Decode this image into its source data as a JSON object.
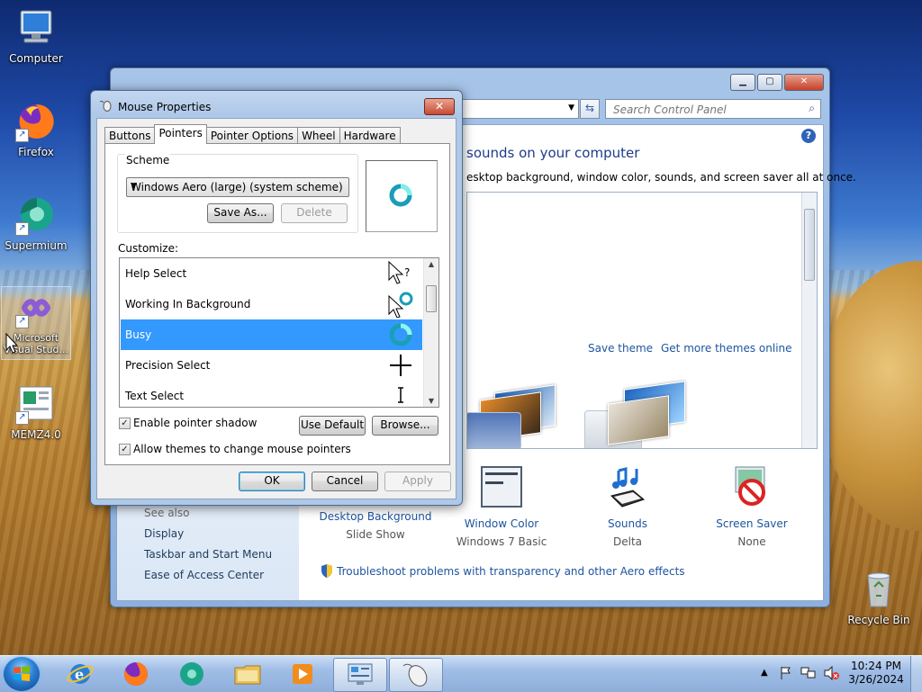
{
  "desktop": {
    "icons": [
      {
        "label": "Computer"
      },
      {
        "label": "Firefox"
      },
      {
        "label": "Supermium"
      },
      {
        "label": "Microsoft Visual Stud..."
      },
      {
        "label": "MEMZ4.0"
      },
      {
        "label": "Recycle Bin"
      }
    ]
  },
  "control_panel": {
    "search_placeholder": "Search Control Panel",
    "heading": "sounds on your computer",
    "subtext": "esktop background, window color, sounds, and screen saver all at once.",
    "save_theme": "Save theme",
    "more_themes": "Get more themes online",
    "tiles": [
      {
        "label": "Desktop Background",
        "sub": "Slide Show"
      },
      {
        "label": "Window Color",
        "sub": "Windows 7 Basic"
      },
      {
        "label": "Sounds",
        "sub": "Delta"
      },
      {
        "label": "Screen Saver",
        "sub": "None"
      }
    ],
    "troubleshoot": "Troubleshoot problems with transparency and other Aero effects",
    "see_also": "See also",
    "left_links": [
      "Display",
      "Taskbar and Start Menu",
      "Ease of Access Center"
    ]
  },
  "mouse_dialog": {
    "title": "Mouse Properties",
    "tabs": [
      "Buttons",
      "Pointers",
      "Pointer Options",
      "Wheel",
      "Hardware"
    ],
    "active_tab": "Pointers",
    "scheme_label": "Scheme",
    "scheme_value": "Windows Aero (large) (system scheme)",
    "save_as": "Save As...",
    "delete": "Delete",
    "customize_label": "Customize:",
    "pointers": [
      {
        "name": "Help Select",
        "cursor": "help-select-cursor"
      },
      {
        "name": "Working In Background",
        "cursor": "working-in-background-cursor"
      },
      {
        "name": "Busy",
        "cursor": "busy-cursor",
        "selected": true
      },
      {
        "name": "Precision Select",
        "cursor": "crosshair-cursor"
      },
      {
        "name": "Text Select",
        "cursor": "text-select-cursor"
      }
    ],
    "enable_shadow": "Enable pointer shadow",
    "allow_themes": "Allow themes to change mouse pointers",
    "use_default": "Use Default",
    "browse": "Browse...",
    "ok": "OK",
    "cancel": "Cancel",
    "apply": "Apply"
  },
  "taskbar": {
    "time": "10:24 PM",
    "date": "3/26/2024"
  }
}
